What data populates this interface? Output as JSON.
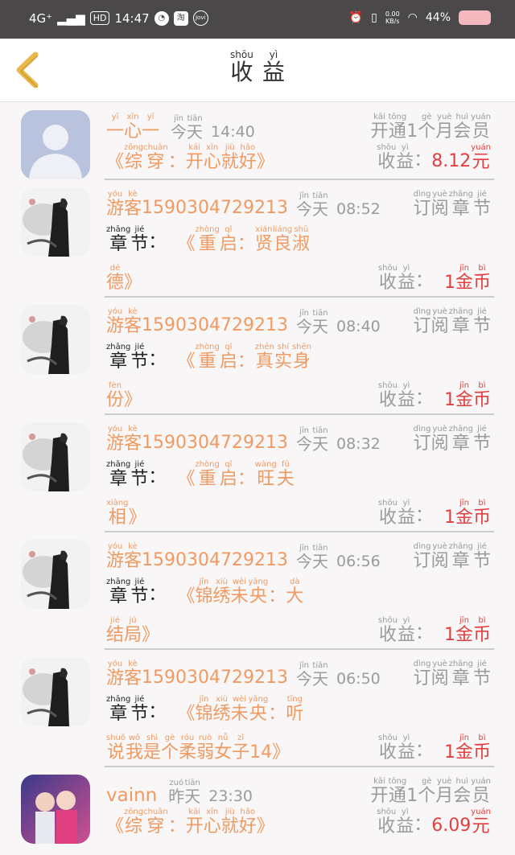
{
  "status_bar": {
    "network": "4G⁺",
    "hd": "HD",
    "time": "14:47",
    "speed_value": "0.00",
    "speed_unit": "KB/s",
    "battery": "44%",
    "colors": {
      "bar": "#4a4848",
      "battery": "#f4b8bf"
    }
  },
  "header": {
    "title": [
      {
        "py": "shōu",
        "hz": "收"
      },
      {
        "py": "yì",
        "hz": "益"
      }
    ]
  },
  "labels": {
    "earn": [
      {
        "py": "shōu",
        "hz": "收"
      },
      {
        "py": "yì",
        "hz": "益"
      }
    ],
    "colon": "：",
    "chapter": [
      {
        "py": "zhāng",
        "hz": "章"
      },
      {
        "py": "jié",
        "hz": "节"
      }
    ],
    "subscribe": [
      {
        "py": "dìng",
        "hz": "订"
      },
      {
        "py": "yuè",
        "hz": "阅"
      },
      {
        "py": "zhāng",
        "hz": "章"
      },
      {
        "py": "jié",
        "hz": "节"
      }
    ],
    "member": [
      {
        "py": "kāi",
        "hz": "开"
      },
      {
        "py": "tōng",
        "hz": "通"
      },
      {
        "py": "",
        "hz": "1"
      },
      {
        "py": "gè",
        "hz": "个"
      },
      {
        "py": "yuè",
        "hz": "月"
      },
      {
        "py": "huì",
        "hz": "会"
      },
      {
        "py": "yuán",
        "hz": "员"
      }
    ],
    "today": [
      {
        "py": "jīn",
        "hz": "今"
      },
      {
        "py": "tiān",
        "hz": "天"
      }
    ],
    "yesterday": [
      {
        "py": "zuó",
        "hz": "昨"
      },
      {
        "py": "tiān",
        "hz": "天"
      }
    ],
    "coin": [
      {
        "py": "",
        "hz": "1"
      },
      {
        "py": "jīn",
        "hz": "金"
      },
      {
        "py": "bì",
        "hz": "币"
      }
    ],
    "yuan": {
      "py": "yuán",
      "hz": "元"
    },
    "guest": [
      {
        "py": "yóu",
        "hz": "游"
      },
      {
        "py": "kè",
        "hz": "客"
      }
    ]
  },
  "items": [
    {
      "type": "member",
      "avatar": "default-avatar",
      "user": [
        {
          "py": "yī",
          "hz": "一"
        },
        {
          "py": "xīn",
          "hz": "心"
        },
        {
          "py": "yī",
          "hz": "一"
        }
      ],
      "day": "today",
      "time": "14:40",
      "book": "《综穿：开心就好》",
      "book_ruby": [
        {
          "py": "",
          "hz": "《"
        },
        {
          "py": "zōng",
          "hz": "综"
        },
        {
          "py": "chuān",
          "hz": "穿"
        },
        {
          "py": "",
          "hz": "："
        },
        {
          "py": "kāi",
          "hz": "开"
        },
        {
          "py": "xīn",
          "hz": "心"
        },
        {
          "py": "jiù",
          "hz": "就"
        },
        {
          "py": "hǎo",
          "hz": "好"
        },
        {
          "py": "",
          "hz": "》"
        }
      ],
      "amount": "8.12"
    },
    {
      "type": "chapter",
      "avatar": "guest-avatar",
      "user": "15903047292​13",
      "user_id": "1590304729213",
      "day": "today",
      "time": "08:52",
      "line1": [
        {
          "py": "",
          "hz": "《"
        },
        {
          "py": "zhòng",
          "hz": "重"
        },
        {
          "py": "qǐ",
          "hz": "启"
        },
        {
          "py": "",
          "hz": "："
        },
        {
          "py": "xián",
          "hz": "贤"
        },
        {
          "py": "liáng",
          "hz": "良"
        },
        {
          "py": "shū",
          "hz": "淑"
        }
      ],
      "line2": [
        {
          "py": "dé",
          "hz": "德"
        },
        {
          "py": "",
          "hz": "》"
        }
      ]
    },
    {
      "type": "chapter",
      "avatar": "guest-avatar",
      "user_id": "1590304729213",
      "day": "today",
      "time": "08:40",
      "line1": [
        {
          "py": "",
          "hz": "《"
        },
        {
          "py": "zhòng",
          "hz": "重"
        },
        {
          "py": "qǐ",
          "hz": "启"
        },
        {
          "py": "",
          "hz": "："
        },
        {
          "py": "zhēn",
          "hz": "真"
        },
        {
          "py": "shí",
          "hz": "实"
        },
        {
          "py": "shēn",
          "hz": "身"
        }
      ],
      "line2": [
        {
          "py": "fèn",
          "hz": "份"
        },
        {
          "py": "",
          "hz": "》"
        }
      ]
    },
    {
      "type": "chapter",
      "avatar": "guest-avatar",
      "user_id": "1590304729213",
      "day": "today",
      "time": "08:32",
      "line1": [
        {
          "py": "",
          "hz": "《"
        },
        {
          "py": "zhòng",
          "hz": "重"
        },
        {
          "py": "qǐ",
          "hz": "启"
        },
        {
          "py": "",
          "hz": "："
        },
        {
          "py": "wàng",
          "hz": "旺"
        },
        {
          "py": "fū",
          "hz": "夫"
        }
      ],
      "line2": [
        {
          "py": "xiàng",
          "hz": "相"
        },
        {
          "py": "",
          "hz": "》"
        }
      ]
    },
    {
      "type": "chapter",
      "avatar": "guest-avatar",
      "user_id": "1590304729213",
      "day": "today",
      "time": "06:56",
      "line1": [
        {
          "py": "",
          "hz": "《"
        },
        {
          "py": "jǐn",
          "hz": "锦"
        },
        {
          "py": "xiù",
          "hz": "绣"
        },
        {
          "py": "wèi",
          "hz": "未"
        },
        {
          "py": "yāng",
          "hz": "央"
        },
        {
          "py": "",
          "hz": "："
        },
        {
          "py": "dà",
          "hz": "大"
        }
      ],
      "line2": [
        {
          "py": "jié",
          "hz": "结"
        },
        {
          "py": "jú",
          "hz": "局"
        },
        {
          "py": "",
          "hz": "》"
        }
      ]
    },
    {
      "type": "chapter",
      "avatar": "guest-avatar",
      "user_id": "1590304729213",
      "day": "today",
      "time": "06:50",
      "line1": [
        {
          "py": "",
          "hz": "《"
        },
        {
          "py": "jǐn",
          "hz": "锦"
        },
        {
          "py": "xiù",
          "hz": "绣"
        },
        {
          "py": "wèi",
          "hz": "未"
        },
        {
          "py": "yāng",
          "hz": "央"
        },
        {
          "py": "",
          "hz": "："
        },
        {
          "py": "tīng",
          "hz": "听"
        }
      ],
      "line2": [
        {
          "py": "shuō",
          "hz": "说"
        },
        {
          "py": "wǒ",
          "hz": "我"
        },
        {
          "py": "shì",
          "hz": "是"
        },
        {
          "py": "gè",
          "hz": "个"
        },
        {
          "py": "róu",
          "hz": "柔"
        },
        {
          "py": "ruò",
          "hz": "弱"
        },
        {
          "py": "nǚ",
          "hz": "女"
        },
        {
          "py": "zǐ",
          "hz": "子"
        },
        {
          "py": "",
          "hz": "14"
        },
        {
          "py": "",
          "hz": "》"
        }
      ]
    },
    {
      "type": "member",
      "avatar": "photo-avatar",
      "user_name": "vainn",
      "day": "yesterday",
      "time": "23:30",
      "book_ruby": [
        {
          "py": "",
          "hz": "《"
        },
        {
          "py": "zōng",
          "hz": "综"
        },
        {
          "py": "chuān",
          "hz": "穿"
        },
        {
          "py": "",
          "hz": "："
        },
        {
          "py": "kāi",
          "hz": "开"
        },
        {
          "py": "xīn",
          "hz": "心"
        },
        {
          "py": "jiù",
          "hz": "就"
        },
        {
          "py": "hǎo",
          "hz": "好"
        },
        {
          "py": "",
          "hz": "》"
        }
      ],
      "amount": "6.09"
    }
  ],
  "colors": {
    "accent_orange": "#f09a62",
    "amount_red": "#e24040",
    "muted_gray": "#9b9b9b",
    "back_arrow": "#e8b84a"
  }
}
